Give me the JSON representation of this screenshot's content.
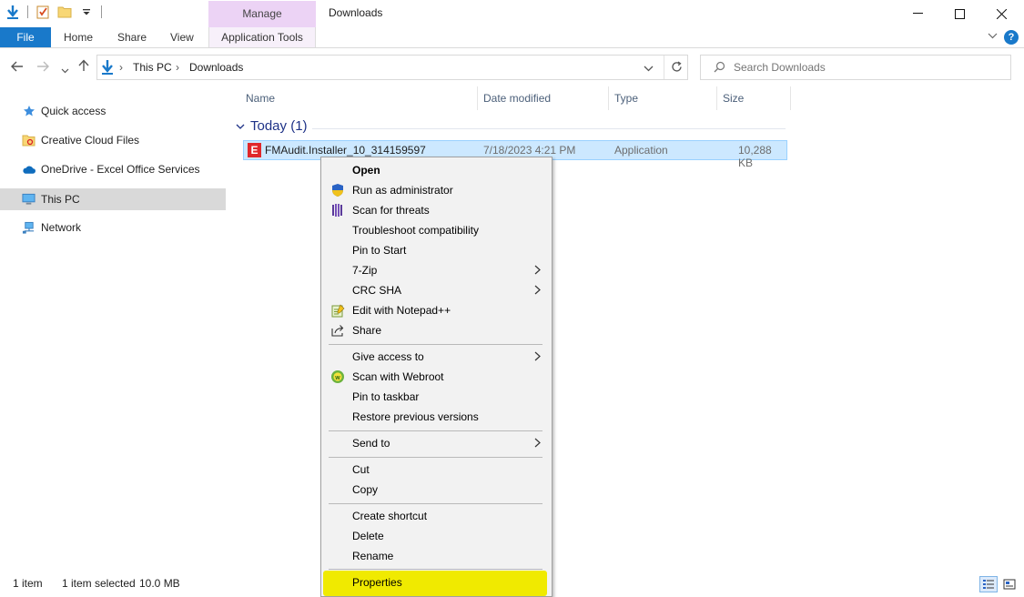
{
  "window": {
    "title": "Downloads",
    "manage_tab": "Manage",
    "controls": {
      "minimize": "—",
      "maximize": "☐",
      "close": "✕"
    }
  },
  "ribbon": {
    "file": "File",
    "tabs": [
      "Home",
      "Share",
      "View"
    ],
    "app_tools": "Application Tools",
    "help": "?"
  },
  "address": {
    "crumbs": [
      "This PC",
      "Downloads"
    ],
    "separator": "›"
  },
  "search": {
    "placeholder": "Search Downloads"
  },
  "nav_pane": [
    {
      "label": "Quick access",
      "icon": "star-icon"
    },
    {
      "label": "Creative Cloud Files",
      "icon": "cc-folder-icon"
    },
    {
      "label": "OneDrive - Excel Office Services",
      "icon": "onedrive-cloud-icon"
    },
    {
      "label": "This PC",
      "icon": "computer-icon",
      "selected": true
    },
    {
      "label": "Network",
      "icon": "network-icon"
    }
  ],
  "columns": [
    "Name",
    "Date modified",
    "Type",
    "Size"
  ],
  "group": {
    "label": "Today (1)",
    "chevron": "⌄"
  },
  "file": {
    "name": "FMAudit.Installer_10_314159597",
    "date": "7/18/2023 4:21 PM",
    "type": "Application",
    "size": "10,288 KB",
    "icon_letter": "E"
  },
  "context_menu": {
    "items": [
      {
        "label": "Open"
      },
      {
        "label": "Run as administrator"
      },
      {
        "label": "Scan for threats"
      },
      {
        "label": "Troubleshoot compatibility"
      },
      {
        "label": "Pin to Start"
      },
      {
        "label": "7-Zip"
      },
      {
        "label": "CRC SHA"
      },
      {
        "label": "Edit with Notepad++"
      },
      {
        "label": "Share"
      },
      {
        "label": "Give access to"
      },
      {
        "label": "Scan with Webroot"
      },
      {
        "label": "Pin to taskbar"
      },
      {
        "label": "Restore previous versions"
      },
      {
        "label": "Send to"
      },
      {
        "label": "Cut"
      },
      {
        "label": "Copy"
      },
      {
        "label": "Create shortcut"
      },
      {
        "label": "Delete"
      },
      {
        "label": "Rename"
      },
      {
        "label": "Properties"
      }
    ],
    "submenu_arrow": "›",
    "highlight_color": "#f0ea00"
  },
  "status": {
    "count": "1 item",
    "selected": "1 item selected",
    "size": "10.0 MB"
  }
}
